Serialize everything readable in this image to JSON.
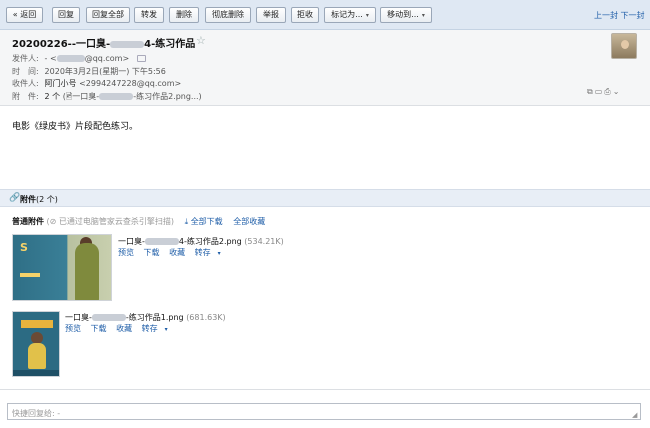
{
  "toolbar": {
    "back": "« 返回",
    "reply": "回复",
    "reply_all": "回复全部",
    "forward": "转发",
    "delete": "删除",
    "delete_forever": "彻底删除",
    "report": "举报",
    "reject": "拒收",
    "mark_as": "标记为...",
    "move_to": "移动到...",
    "prev_next": "上一封 下一封"
  },
  "email": {
    "subject_prefix": "20200226--一口臭-",
    "subject_suffix": "4-练习作品",
    "sender_label": "发件人:",
    "sender_value_prefix": "- <",
    "sender_value_suffix": "@qq.com>",
    "time_label": "时　间:",
    "time_value": "2020年3月2日(星期一) 下午5:56",
    "recipient_label": "收件人:",
    "recipient_name": "阿门小号",
    "recipient_email": "<2994247228@qq.com>",
    "attach_label": "附　件:",
    "attach_count": "2 个",
    "attach_preview_prefix": "(",
    "attach_preview_name": "一口臭-",
    "attach_preview_suffix": "-练习作品2.png...)"
  },
  "body": {
    "text": "电影《绿皮书》片段配色练习。"
  },
  "attachments": {
    "header_title": "附件",
    "header_count": "(2 个)",
    "normal_label": "普通附件",
    "scan_note": "(⊘ 已通过电脑管家云查杀引擎扫描)",
    "download_all": "全部下载",
    "save_all": "全部收藏",
    "items": [
      {
        "name_prefix": "一口臭-",
        "name_suffix": "4-练习作品2.png",
        "size": "(534.21K)",
        "preview": "预览",
        "download": "下载",
        "save": "收藏",
        "transfer": "转存"
      },
      {
        "name_prefix": "一口臭-",
        "name_suffix": "-练习作品1.png",
        "size": "(681.63K)",
        "preview": "预览",
        "download": "下载",
        "save": "收藏",
        "transfer": "转存"
      }
    ]
  },
  "reply_box": {
    "placeholder": "快捷回复给: -"
  },
  "colors": {
    "link": "#1f5ea8",
    "toolbar_bg": "#dfe8f3",
    "attach_header_bg": "#e8eef6"
  }
}
